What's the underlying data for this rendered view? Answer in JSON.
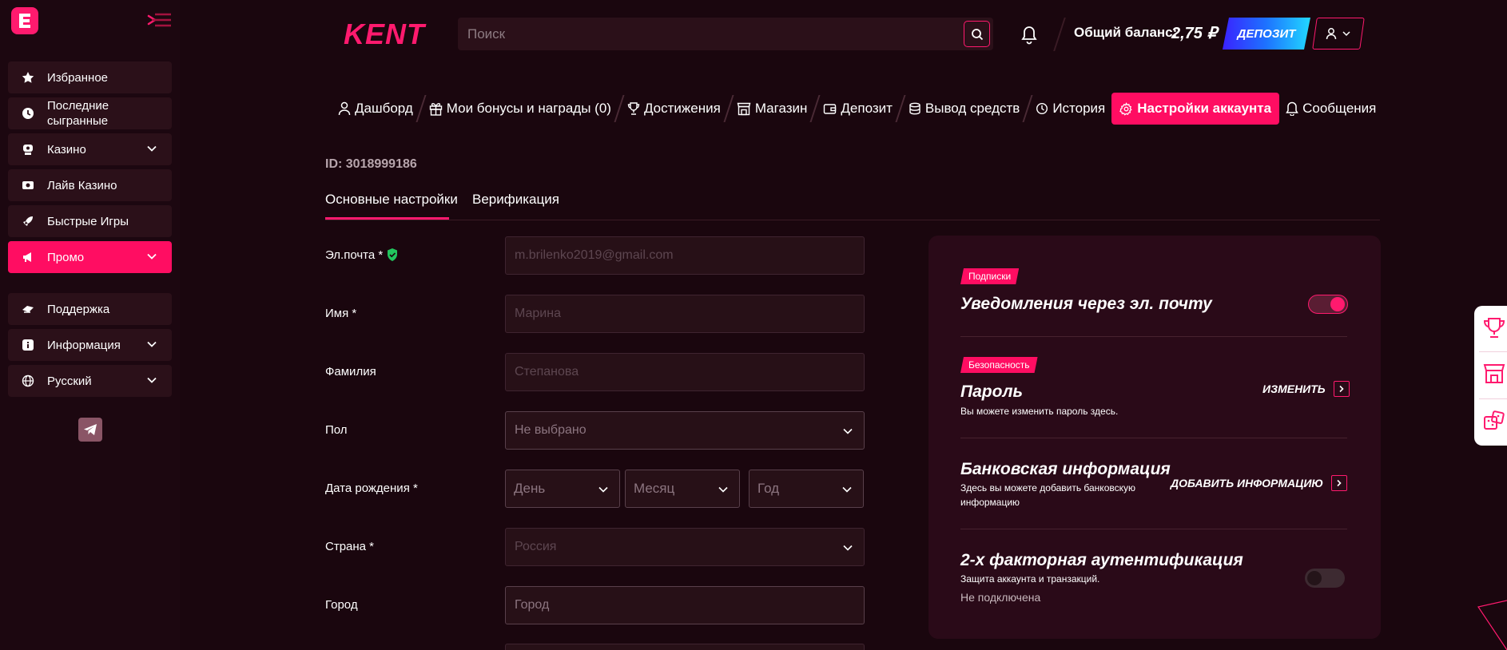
{
  "sidebar": {
    "items": [
      {
        "label": "Избранное",
        "icon": "star-icon"
      },
      {
        "label": "Последние сыгранные",
        "icon": "clock-icon"
      },
      {
        "label": "Казино",
        "icon": "casino-icon"
      },
      {
        "label": "Лайв Казино",
        "icon": "live-casino-icon"
      },
      {
        "label": "Быстрые Игры",
        "icon": "rocket-icon"
      },
      {
        "label": "Промо",
        "icon": "megaphone-icon"
      },
      {
        "label": "Поддержка",
        "icon": "support-icon"
      },
      {
        "label": "Информация",
        "icon": "info-icon"
      },
      {
        "label": "Русский",
        "icon": "globe-icon"
      }
    ]
  },
  "header": {
    "logo_text": "KENT",
    "search_placeholder": "Поиск",
    "balance_label": "Общий баланс:",
    "balance_value": "2,75 ₽",
    "deposit_label": "ДЕПОЗИТ"
  },
  "topnav": [
    {
      "label": "Дашборд"
    },
    {
      "label": "Мои бонусы и награды (0)"
    },
    {
      "label": "Достижения"
    },
    {
      "label": "Магазин"
    },
    {
      "label": "Депозит"
    },
    {
      "label": "Вывод средств"
    },
    {
      "label": "История"
    },
    {
      "label": "Настройки аккаунта"
    },
    {
      "label": "Сообщения"
    }
  ],
  "account": {
    "id_text": "ID: 3018999186",
    "tabs": [
      {
        "label": "Основные настройки"
      },
      {
        "label": "Верификация"
      }
    ]
  },
  "form": {
    "email": {
      "label": "Эл.почта *",
      "value": "m.brilenko2019@gmail.com"
    },
    "first_name": {
      "label": "Имя *",
      "value": "Марина"
    },
    "last_name": {
      "label": "Фамилия",
      "value": "Степанова"
    },
    "gender": {
      "label": "Пол",
      "value": "Не выбрано"
    },
    "birth_date": {
      "label": "Дата рождения *",
      "day": "День",
      "month": "Месяц",
      "year": "Год"
    },
    "country": {
      "label": "Страна *",
      "value": "Россия"
    },
    "city": {
      "label": "Город",
      "placeholder": "Город"
    }
  },
  "settings_panel": {
    "subscriptions": {
      "badge": "Подписки",
      "title": "Уведомления через эл. почту",
      "enabled": true
    },
    "security": {
      "badge": "Безопасность"
    },
    "password": {
      "title": "Пароль",
      "description": "Вы можете изменить пароль здесь.",
      "action": "ИЗМЕНИТЬ"
    },
    "bank": {
      "title": "Банковская информация",
      "description_line1": "Здесь вы можете добавить банковскую",
      "description_line2": "информацию",
      "action": "ДОБАВИТЬ ИНФОРМАЦИЮ"
    },
    "two_factor": {
      "title": "2-х факторная аутентификация",
      "description": "Защита аккаунта и транзакций.",
      "status": "Не подключена",
      "enabled": false
    }
  },
  "colors": {
    "accent": "#ff0d62",
    "background": "#1a060e",
    "sidebar_item": "#2b1019"
  }
}
